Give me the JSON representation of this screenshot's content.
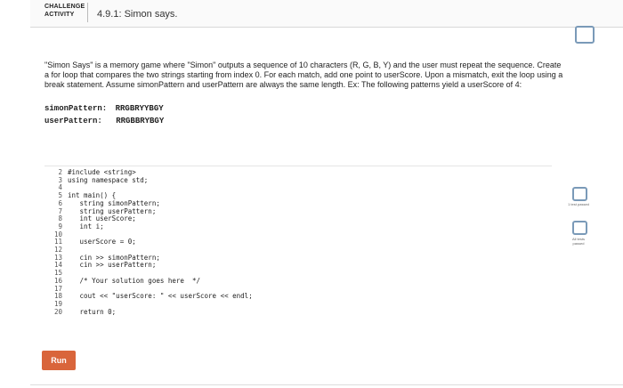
{
  "header": {
    "badge_line1": "CHALLENGE",
    "badge_line2": "ACTIVITY",
    "title": "4.9.1: Simon says."
  },
  "description": "\"Simon Says\" is a memory game where \"Simon\" outputs a sequence of 10 characters (R, G, B, Y) and the user must repeat the sequence. Create a for loop that compares the two strings starting from index 0. For each match, add one point to userScore. Upon a mismatch, exit the loop using a break statement. Assume simonPattern and userPattern are always the same length. Ex: The following patterns yield a userScore of 4:",
  "example": {
    "simon_label": "simonPattern:",
    "simon_value": "RRGBRYYBGY",
    "user_label": "userPattern:",
    "user_value": "RRGBBRYBGY"
  },
  "code": {
    "line_numbers": [
      "2",
      "3",
      "4",
      "5",
      "6",
      "7",
      "8",
      "9",
      "10",
      "11",
      "12",
      "13",
      "14",
      "15",
      "16",
      "17",
      "18",
      "19",
      "20"
    ],
    "lines": [
      "#include <string>",
      "using namespace std;",
      "",
      "int main() {",
      "   string simonPattern;",
      "   string userPattern;",
      "   int userScore;",
      "   int i;",
      "",
      "   userScore = 0;",
      "",
      "   cin >> simonPattern;",
      "   cin >> userPattern;",
      "",
      "   /* Your solution goes here  */",
      "",
      "   cout << \"userScore: \" << userScore << endl;",
      "",
      "   return 0;"
    ]
  },
  "side": {
    "test1_label": "1 test passed",
    "test2_label": "All tests passed"
  },
  "run_label": "Run"
}
